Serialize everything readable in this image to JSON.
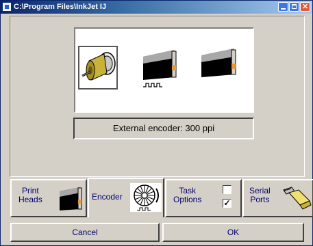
{
  "window": {
    "title": "C:\\Program Files\\InkJet  IJ"
  },
  "encoder": {
    "options": [
      {
        "name": "external-encoder",
        "selected": true
      },
      {
        "name": "internal-pulse",
        "selected": false
      },
      {
        "name": "internal-no-encoder",
        "selected": false
      }
    ],
    "status": "External encoder: 300 ppi"
  },
  "tabs": {
    "print_heads_line1": "Print",
    "print_heads_line2": "Heads",
    "encoder": "Encoder",
    "task_options_line1": "Task",
    "task_options_line2": "Options",
    "serial_ports_line1": "Serial",
    "serial_ports_line2": "Ports",
    "task_checkbox_1_checked": false,
    "task_checkbox_2_checked": true,
    "task_checkbox_2_glyph": "✓"
  },
  "buttons": {
    "cancel": "Cancel",
    "ok": "OK"
  },
  "colors": {
    "titlebar_start": "#0a246a",
    "label_text": "#00006a",
    "face": "#d4d0c8"
  }
}
